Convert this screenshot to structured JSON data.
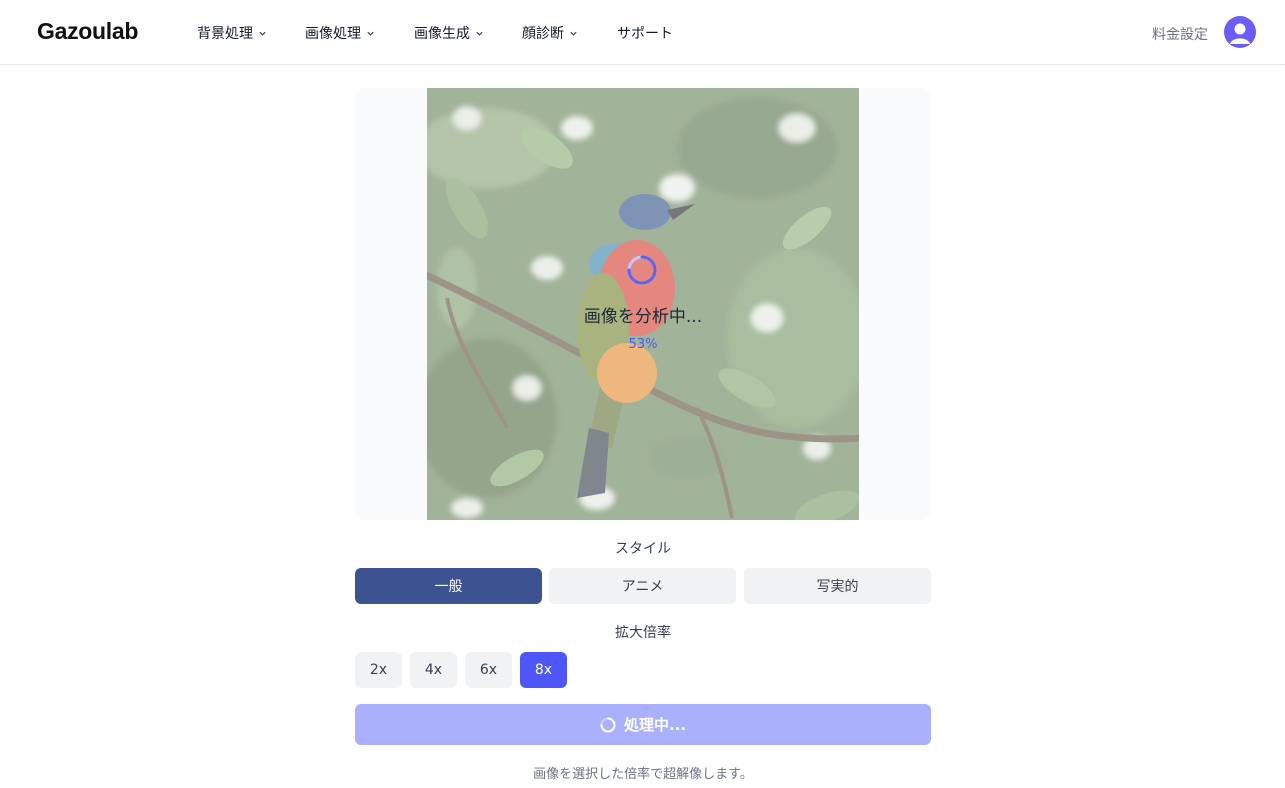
{
  "header": {
    "logo": "Gazoulab",
    "nav": [
      {
        "label": "背景処理",
        "has_dropdown": true
      },
      {
        "label": "画像処理",
        "has_dropdown": true
      },
      {
        "label": "画像生成",
        "has_dropdown": true
      },
      {
        "label": "顔診断",
        "has_dropdown": true
      },
      {
        "label": "サポート",
        "has_dropdown": false
      }
    ],
    "pricing": "料金設定",
    "avatar_icon": "user-avatar-icon"
  },
  "preview": {
    "status_text": "画像を分析中...",
    "progress_percent": "53%",
    "progress_value": 0.53
  },
  "style": {
    "label": "スタイル",
    "options": [
      "一般",
      "アニメ",
      "写実的"
    ],
    "selected": "一般"
  },
  "scale": {
    "label": "拡大倍率",
    "options": [
      "2x",
      "4x",
      "6x",
      "8x"
    ],
    "selected": "8x"
  },
  "process_button": {
    "label": "処理中..."
  },
  "hint": "画像を選択した倍率で超解像します。",
  "colors": {
    "accent": "#4f56f7",
    "style_active": "#3d5290",
    "process_disabled": "#aab0fb"
  }
}
